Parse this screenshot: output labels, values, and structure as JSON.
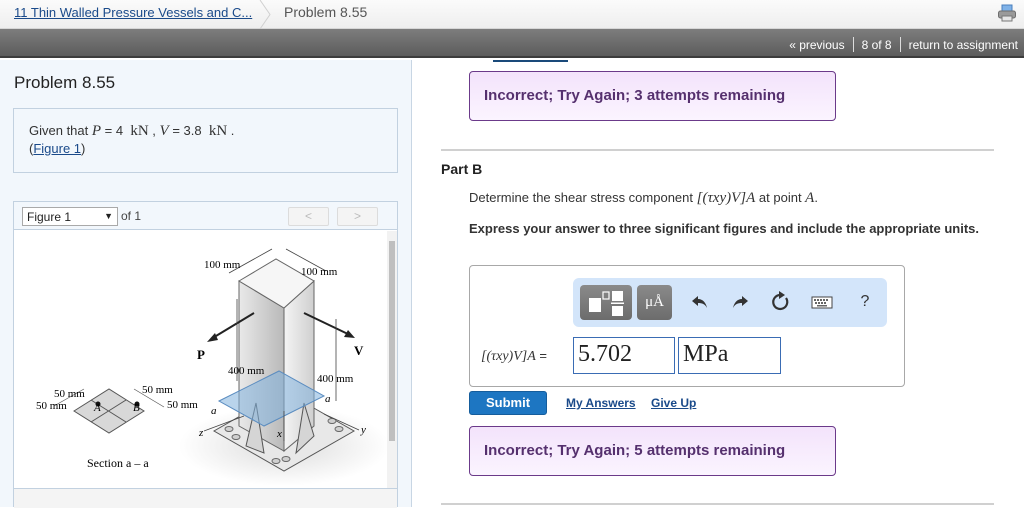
{
  "breadcrumb": {
    "parent": "11 Thin Walled Pressure Vessels and C...",
    "current": "Problem 8.55"
  },
  "nav": {
    "previous": "« previous",
    "position": "8 of 8",
    "return": "return to assignment"
  },
  "problem": {
    "title": "Problem 8.55",
    "given_prefix": "Given that ",
    "P_symbol": "P",
    "P_eq": " = 4 ",
    "P_unit": "kN",
    "sep": " , ",
    "V_symbol": "V",
    "V_eq": " = 3.8 ",
    "V_unit": "kN",
    "given_suffix": " .",
    "figure_link_open": "(",
    "figure_link": "Figure 1",
    "figure_link_close": ")"
  },
  "figure": {
    "selected": "Figure 1",
    "of": "of 1",
    "prev": "<",
    "next": ">",
    "labels": {
      "dim_top_left": "100 mm",
      "dim_top_right": "100 mm",
      "P": "P",
      "V": "V",
      "dim_height_left": "400 mm",
      "dim_height_right": "400 mm",
      "sec_50_a": "50 mm",
      "sec_50_b": "50 mm",
      "sec_50_c": "50 mm",
      "sec_50_d": "50 mm",
      "point_A": "A",
      "point_B": "B",
      "a_left": "a",
      "a_right": "a",
      "axis_z": "z",
      "axis_x": "x",
      "axis_y": "y",
      "section_caption": "Section a – a"
    }
  },
  "feedback": {
    "top": "Incorrect; Try Again; 3 attempts remaining",
    "bottom": "Incorrect; Try Again; 5 attempts remaining"
  },
  "part": {
    "label": "Part B",
    "question_prefix": "Determine the shear stress component ",
    "question_symbol": "[(τxy)V]A",
    "question_mid": " at point ",
    "question_point": "A",
    "question_suffix": ".",
    "instructions": "Express your answer to three significant figures and include the appropriate units."
  },
  "toolbar": {
    "units_button": "μÅ",
    "undo": "↶",
    "redo": "↷",
    "reset": "↻",
    "help": "?"
  },
  "answer": {
    "label": "[(τxy)V]A",
    "equals": " =",
    "value": "5.702",
    "units": "MPa"
  },
  "actions": {
    "submit": "Submit",
    "my_answers": "My Answers",
    "give_up": "Give Up"
  }
}
